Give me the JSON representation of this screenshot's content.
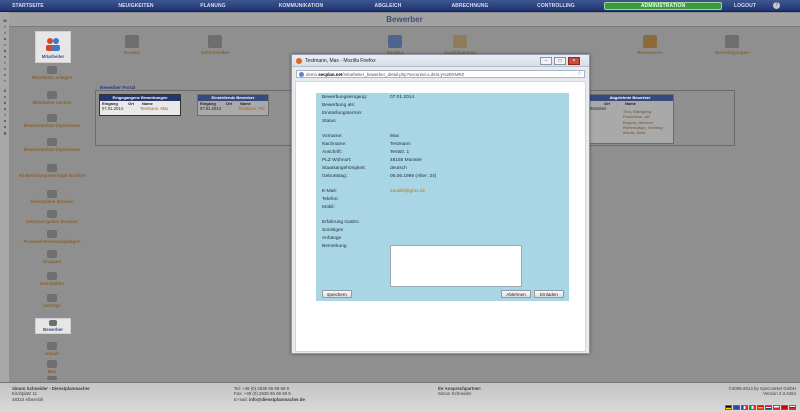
{
  "nav": {
    "items": [
      "STARTSEITE",
      "NEUIGKEITEN",
      "PLANUNG",
      "KOMMUNIKATION",
      "ABGLEICH",
      "ABRECHNUNG",
      "CONTROLLING",
      "ADMINISTRATION",
      "LOGOUT"
    ],
    "active": "ADMINISTRATION"
  },
  "page": {
    "title": "Bewerber"
  },
  "sidebar": {
    "top_label": "Mitarbeiter",
    "items": [
      "Mitarbeiter anlegen",
      "Mitarbeiter suchen",
      "Mitarbeiterliste importieren",
      "Mitarbeiterliste importieren",
      "Alt-Befristungsverträge drucken",
      "Dienstpläne drucken",
      "Dienstvorgaben drucken",
      "Personal-Erfassungsbögen",
      "Gruppen",
      "Geschäften",
      "Vorträge"
    ],
    "selected": "Bewerber",
    "after": [
      "Urlaub",
      "Mas",
      "Plus"
    ]
  },
  "modules": [
    "Kunden",
    "Schnittstellen",
    "",
    "",
    "Struktur",
    "Qualifikationen",
    "",
    "Ressourcen",
    "Berechtigungen"
  ],
  "portal": {
    "title": "Bewerber Portal",
    "incoming": {
      "header": "Eingegangene Bewerbungen",
      "columns": [
        "Eingang",
        "Ort",
        "Name"
      ],
      "rows": [
        {
          "date": "07.01.2014",
          "ort": "",
          "name": "Testmann, Max"
        }
      ]
    },
    "invited": {
      "header": "Einstellende Bewerber",
      "columns": [
        "Eingang",
        "Ort",
        "Name"
      ],
      "rows": [
        {
          "date": "07.01.2014",
          "ort": "",
          "name": "Testmann, Pia"
        }
      ]
    },
    "rejected": {
      "header": "Abgelehnte Bewerber",
      "columns": [
        "Ort",
        "Name"
      ],
      "rows": [
        {
          "ort": "Testorten",
          "name": "Test, Wolfgang"
        },
        {
          "ort": "",
          "name": "Fastenroe, Alf"
        },
        {
          "ort": "",
          "name": "Engels, Hannes"
        },
        {
          "ort": "",
          "name": "Riefenstage, Vorthag"
        },
        {
          "ort": "",
          "name": "Wurth, Nina"
        }
      ]
    }
  },
  "popup": {
    "title": "Testmann, Max - Mozilla Firefox",
    "url_prefix": "demo.",
    "url_domain": "secplan.net",
    "url_path": "/mitarbeiter_bewerber_detail.php?secureid=LdsSLy%2BXMRZ",
    "fields": [
      {
        "label": "Bewerbungseingang:",
        "value": "07.01.2014"
      },
      {
        "label": "Bewerbung als:",
        "value": ""
      },
      {
        "label": "Einstellungstermin:",
        "value": ""
      },
      {
        "label": "Status",
        "value": ""
      },
      {
        "label": "Vorname:",
        "value": "Max"
      },
      {
        "label": "Nachname:",
        "value": "Testmann"
      },
      {
        "label": "Anschrift:",
        "value": "Teststr. 1"
      },
      {
        "label": "PLZ Wohnort:",
        "value": "48165 Münster"
      },
      {
        "label": "Staatsangehörigkeit:",
        "value": "deutsch"
      },
      {
        "label": "Geburtstag:",
        "value": "05.06.1989 (Alter: 24)"
      },
      {
        "label": "E-Mail:",
        "value": "sauskli@gmx.de"
      },
      {
        "label": "Telefon:",
        "value": ""
      },
      {
        "label": "Mobil:",
        "value": ""
      },
      {
        "label": "Erfahrung Gastro",
        "value": ""
      },
      {
        "label": "Sonstiges",
        "value": ""
      },
      {
        "label": "Anhänge",
        "value": ""
      },
      {
        "label": "Bemerkung",
        "value": ""
      }
    ],
    "buttons": {
      "save": "speichern",
      "reject": "Ablehnen",
      "invite": "Einladen"
    }
  },
  "footer": {
    "company": "Simon Schneider - Dienstplanmacher",
    "street": "Kirchplatz 11",
    "city": "48324 Albersloh",
    "phone": "Tel: +49 (0) 2535 95 69 69 0",
    "fax": "Fax: +49 (0) 2535 95 69 69 5",
    "email_label": "E-mail:",
    "email": "info@dienstplanmacher.de",
    "contact_label": "Ihr Ansprechpartner:",
    "contact": "Simon Schneider",
    "copyright": "©2005-2014 by SysConNet GmbH",
    "version": "Version 2.3.4464"
  },
  "vstrip_letters": [
    "M",
    "i",
    "t",
    "a",
    "r",
    "b",
    "e",
    "i",
    "t",
    "e",
    "r",
    "S",
    "c",
    "h",
    "u",
    "l",
    "u",
    "n",
    "g"
  ],
  "colors": {
    "accent": "#3c9a3c",
    "nav": "#2a3f7c",
    "link": "#b75a1e",
    "form_bg": "#a9d6e4"
  }
}
